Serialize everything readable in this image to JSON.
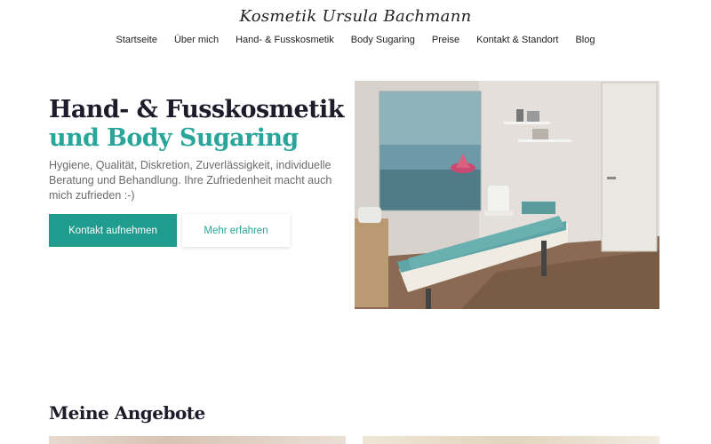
{
  "site": {
    "logo": "Kosmetik Ursula Bachmann"
  },
  "nav": {
    "items": [
      {
        "label": "Startseite"
      },
      {
        "label": "Über mich"
      },
      {
        "label": "Hand- & Fusskosmetik"
      },
      {
        "label": "Body Sugaring"
      },
      {
        "label": "Preise"
      },
      {
        "label": "Kontakt & Standort"
      },
      {
        "label": "Blog"
      }
    ]
  },
  "hero": {
    "title_line1": "Hand- & Fusskosmetik",
    "title_line2": "und Body Sugaring",
    "text": "Hygiene, Qualität, Diskretion, Zuverlässigkeit, individuelle Beratung und Behandlung. Ihre Zufriedenheit macht auch mich zufrieden :-)",
    "primary_button": "Kontakt aufnehmen",
    "secondary_button": "Mehr erfahren"
  },
  "offers": {
    "title": "Meine Angebote"
  },
  "colors": {
    "accent": "#2aa59a",
    "button": "#1f9c8e",
    "heading": "#1c1c2b"
  }
}
